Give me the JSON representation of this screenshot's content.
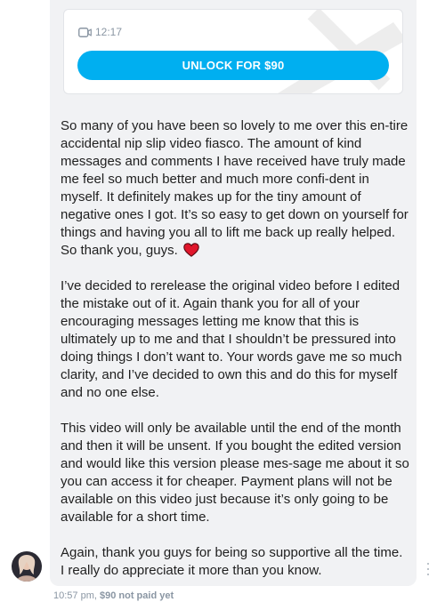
{
  "locked_media": {
    "duration": "12:17",
    "unlock_label": "UNLOCK FOR $90"
  },
  "message": {
    "paragraphs": [
      "So many of you have been so lovely to me over this en-tire accidental nip slip video fiasco. The amount of kind messages and comments I have received have truly made me feel so much better and much more confi-dent in myself. It definitely makes up for the tiny amount of negative ones I got. It’s so easy to get down on yourself for things and having you all to lift me back up really helped. So thank you, guys.",
      "I’ve decided to rerelease the original video before I edited the mistake out of it. Again thank you for all of your encouraging messages letting me know that this is ultimately up to me and that I shouldn’t be pressured into doing things I don’t want to. Your words gave me so much clarity, and I’ve decided to own this and do this for myself and no one else.",
      "This video will only be available until the end of the month and then it will be unsent. If you bought the edited version and would like this version please mes-sage me about it so you can access it for cheaper. Payment plans will not be available on this video just because it’s only going to be available for a short time.",
      "Again, thank you guys for being so supportive all the time. I really do appreciate it more than you know."
    ]
  },
  "meta": {
    "time": "10:57 pm,",
    "status": "$90 not paid yet"
  },
  "icons": {
    "duration": "video-camera-icon",
    "heart": "heart-emoji-icon",
    "more": "more-vertical-icon"
  },
  "colors": {
    "accent": "#00aff0",
    "bubble": "#f1f2f4",
    "muted": "#8a96a3",
    "heart": "#e0162b"
  }
}
